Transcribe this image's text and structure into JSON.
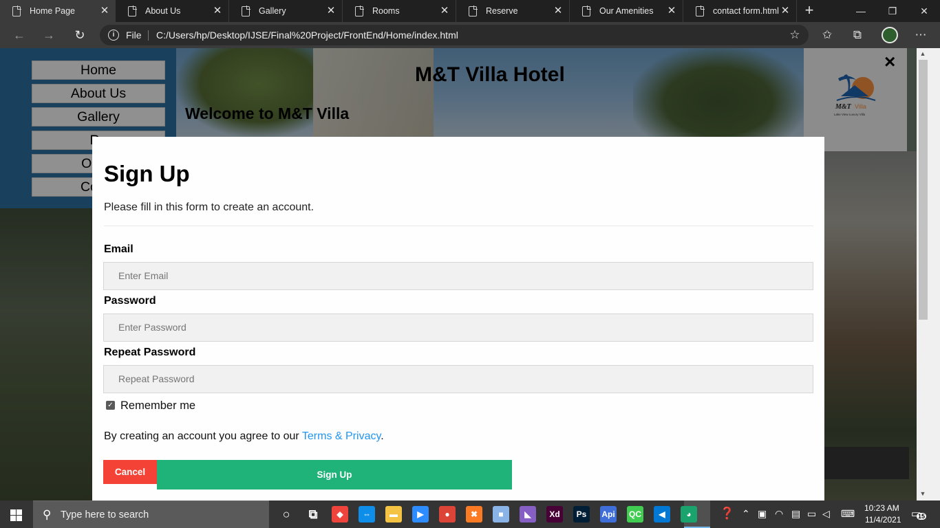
{
  "browser": {
    "tabs": [
      {
        "label": "Home Page"
      },
      {
        "label": "About Us"
      },
      {
        "label": "Gallery"
      },
      {
        "label": "Rooms"
      },
      {
        "label": "Reserve"
      },
      {
        "label": "Our Amenities"
      },
      {
        "label": "contact form.html"
      }
    ],
    "close_glyph": "✕",
    "new_tab_glyph": "+",
    "address": {
      "scheme_label": "File",
      "url": "C:/Users/hp/Desktop/IJSE/Final%20Project/FrontEnd/Home/index.html"
    }
  },
  "page": {
    "nav": [
      {
        "label": "Home"
      },
      {
        "label": "About Us"
      },
      {
        "label": "Gallery"
      },
      {
        "label": "Ro"
      },
      {
        "label": "Our A"
      },
      {
        "label": "Conta"
      }
    ],
    "title": "M&T Villa Hotel",
    "welcome": "Welcome to M&T Villa",
    "logo": {
      "brand": "M&T Villa",
      "tagline": "Lake View Luxury Villa"
    },
    "close_glyph": "×"
  },
  "signup": {
    "title": "Sign Up",
    "subtitle": "Please fill in this form to create an account.",
    "email_label": "Email",
    "email_placeholder": "Enter Email",
    "password_label": "Password",
    "password_placeholder": "Enter Password",
    "repeat_label": "Repeat Password",
    "repeat_placeholder": "Repeat Password",
    "remember_label": "Remember me",
    "remember_checked": true,
    "terms_prefix": "By creating an account you agree to our ",
    "terms_link": "Terms & Privacy",
    "terms_suffix": ".",
    "cancel_label": "Cancel",
    "signup_label": "Sign Up"
  },
  "taskbar": {
    "search_placeholder": "Type here to search",
    "time": "10:23 AM",
    "date": "11/4/2021",
    "notification_count": "15",
    "apps": [
      {
        "name": "cortana-icon",
        "glyph": "○",
        "color": "transparent"
      },
      {
        "name": "task-view-icon",
        "glyph": "⧉",
        "color": "transparent"
      },
      {
        "name": "anydesk-icon",
        "glyph": "◆",
        "color": "#ef443b"
      },
      {
        "name": "teamviewer-icon",
        "glyph": "⇔",
        "color": "#0e8ee9"
      },
      {
        "name": "file-explorer-icon",
        "glyph": "▬",
        "color": "#f5c343"
      },
      {
        "name": "zoom-icon",
        "glyph": "▶",
        "color": "#2d8cff"
      },
      {
        "name": "chrome-icon",
        "glyph": "●",
        "color": "#db4437"
      },
      {
        "name": "xampp-icon",
        "glyph": "✖",
        "color": "#fb7a24"
      },
      {
        "name": "virtualbox-icon",
        "glyph": "■",
        "color": "#8ab4e8"
      },
      {
        "name": "visual-studio-icon",
        "glyph": "◣",
        "color": "#865fc5"
      },
      {
        "name": "adobe-xd-icon",
        "glyph": "Xd",
        "color": "#470137"
      },
      {
        "name": "photoshop-icon",
        "glyph": "Ps",
        "color": "#001e36"
      },
      {
        "name": "postman-icon",
        "glyph": "Api",
        "color": "#3f6ed8"
      },
      {
        "name": "qt-creator-icon",
        "glyph": "QC",
        "color": "#41cd52"
      },
      {
        "name": "vscode-icon",
        "glyph": "◀",
        "color": "#0078d4"
      },
      {
        "name": "edge-icon",
        "glyph": "◕",
        "color": "#1aa36d"
      }
    ]
  }
}
